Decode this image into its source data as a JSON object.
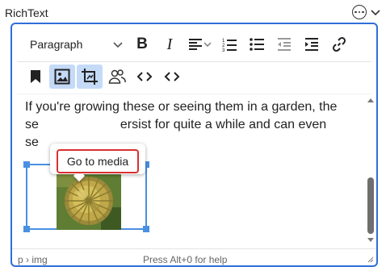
{
  "field": {
    "label": "RichText"
  },
  "toolbar": {
    "format_value": "Paragraph",
    "bold": "B",
    "italic": "I"
  },
  "content": {
    "line1": "If you're growing these or seeing them in a garden, the",
    "line2_a": "se",
    "line2_b": "ersist for quite a while and can even",
    "line3": "se"
  },
  "tooltip": {
    "button_label": "Go to media"
  },
  "status": {
    "path": "p › img",
    "help": "Press Alt+0 for help"
  },
  "icons": {
    "more": "more-options-icon",
    "collapse": "chevron-down-icon",
    "link": "link-icon",
    "bookmark": "bookmark-icon",
    "image": "image-icon",
    "crop": "crop-icon",
    "people": "users-icon",
    "code": "code-icon"
  },
  "colors": {
    "accent": "#2f6fd8",
    "selection": "#4a90e2",
    "active_button_bg": "#c4daf7",
    "tooltip_outline": "#d93030"
  }
}
